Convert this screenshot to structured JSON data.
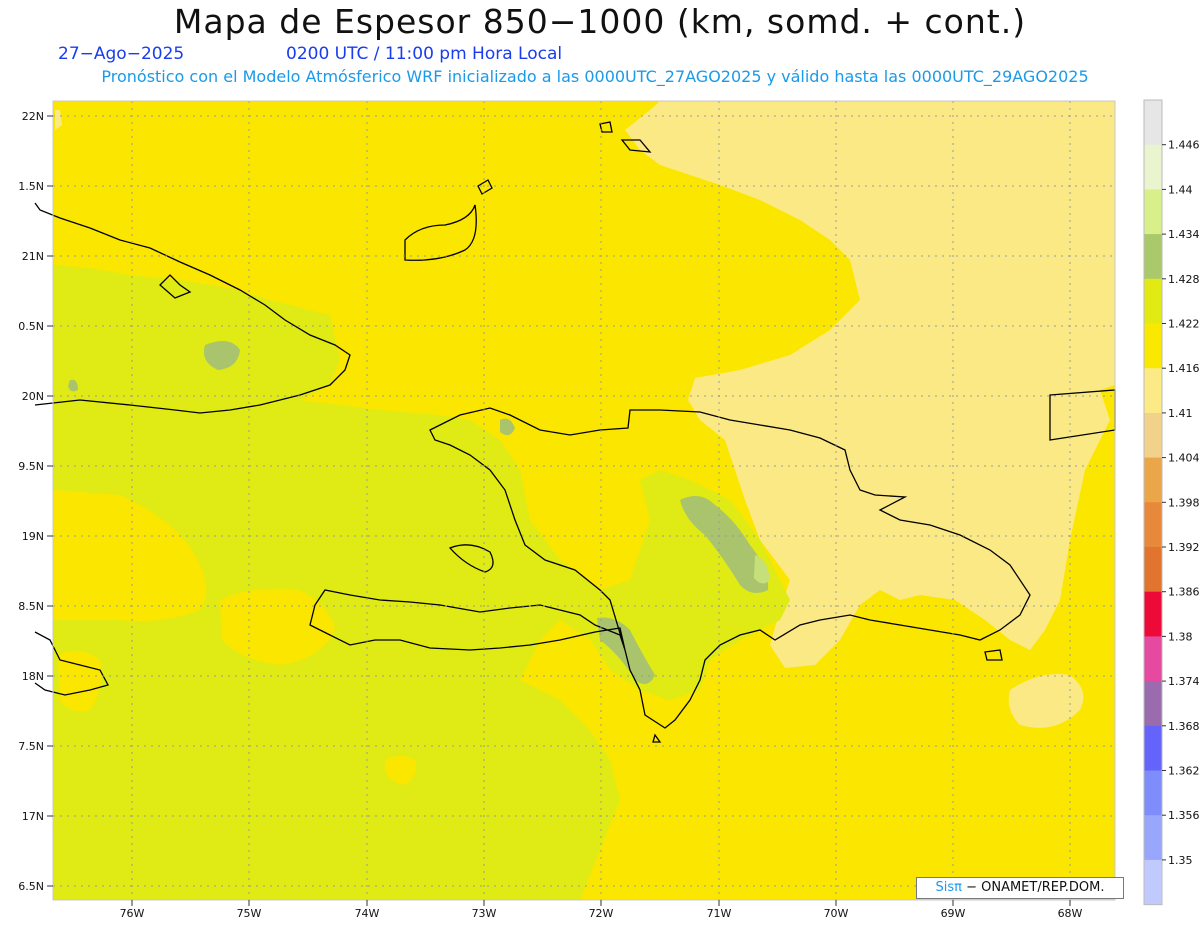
{
  "title": "Mapa de Espesor 850−1000 (km, somd. + cont.)",
  "date": "27−Ago−2025",
  "time": "0200 UTC / 11:00 pm Hora Local",
  "subtitle": "Pronóstico con el Modelo Atmósferico WRF inicializado a las 0000UTC_27AGO2025 y válido hasta las  0000UTC_29AGO2025",
  "credit": {
    "sis": "Sisπ",
    "rest": "− ONAMET/REP.DOM."
  },
  "lat_labels": [
    "22N",
    "1.5N",
    "21N",
    "0.5N",
    "20N",
    "9.5N",
    "19N",
    "8.5N",
    "18N",
    "7.5N",
    "17N",
    "6.5N"
  ],
  "lon_labels": [
    "76W",
    "75W",
    "74W",
    "73W",
    "72W",
    "71W",
    "70W",
    "69W",
    "68W"
  ],
  "colorbar": {
    "labels": [
      "1.446",
      "1.44",
      "1.434",
      "1.428",
      "1.422",
      "1.416",
      "1.41",
      "1.404",
      "1.398",
      "1.392",
      "1.386",
      "1.38",
      "1.374",
      "1.368",
      "1.362",
      "1.356",
      "1.35"
    ],
    "colors": [
      "#e6e6e6",
      "#eaf5cf",
      "#d9f08a",
      "#a9c96a",
      "#e2ea14",
      "#f9e800",
      "#fcea86",
      "#f2d28a",
      "#eca64a",
      "#e8883a",
      "#e17530",
      "#ee0a38",
      "#e54aa0",
      "#9a6cae",
      "#6464fc",
      "#7e8cfc",
      "#98a6fc",
      "#c0cafc"
    ]
  },
  "fill_colors": {
    "ocean_high": "#fbe600",
    "pale": "#fbe986",
    "green": "#e0ea14",
    "dark_green": "#a9c46c",
    "light_green": "#c5e07a"
  }
}
